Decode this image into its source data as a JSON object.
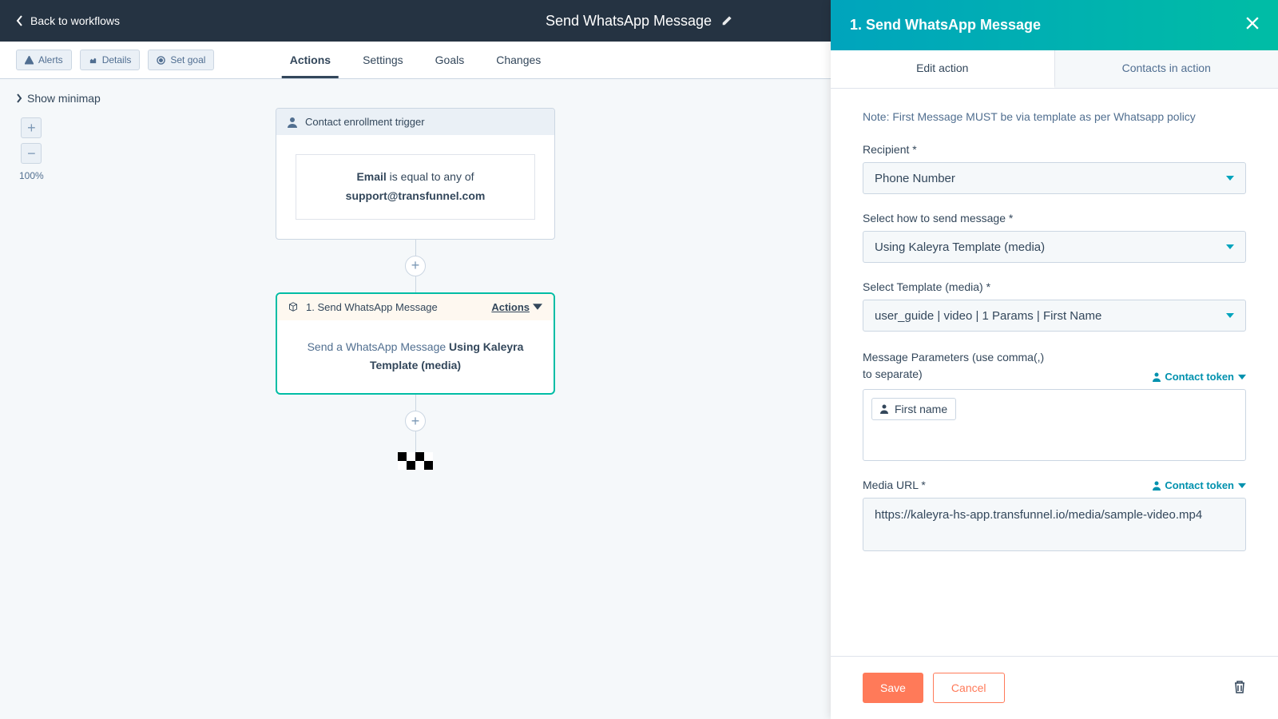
{
  "topbar": {
    "back": "Back to workflows",
    "title": "Send WhatsApp Message"
  },
  "toolbar": {
    "alerts": "Alerts",
    "details": "Details",
    "setgoal": "Set goal"
  },
  "tabs": [
    "Actions",
    "Settings",
    "Goals",
    "Changes"
  ],
  "minimap": "Show minimap",
  "zoom": "100%",
  "trigger": {
    "title": "Contact enrollment trigger",
    "field": "Email",
    "mid": " is equal to any of ",
    "value": "support@transfunnel.com"
  },
  "step1": {
    "title": "1. Send WhatsApp Message",
    "actions": "Actions",
    "body_pre": "Send a WhatsApp Message ",
    "body_bold": "Using Kaleyra Template (media)"
  },
  "panel": {
    "title": "1. Send WhatsApp Message",
    "tab_edit": "Edit action",
    "tab_contacts": "Contacts in action",
    "note": "Note: First Message MUST be via template as per Whatsapp policy",
    "recipient_label": "Recipient *",
    "recipient_value": "Phone Number",
    "how_label": "Select how to send message *",
    "how_value": "Using Kaleyra Template (media)",
    "template_label": "Select Template (media) *",
    "template_value": "user_guide | video | 1 Params | First Name",
    "params_label": "Message Parameters (use comma(,) to separate)",
    "params_chip": "First name",
    "contact_token": "Contact token",
    "media_label": "Media URL *",
    "media_value": "https://kaleyra-hs-app.transfunnel.io/media/sample-video.mp4",
    "save": "Save",
    "cancel": "Cancel"
  }
}
